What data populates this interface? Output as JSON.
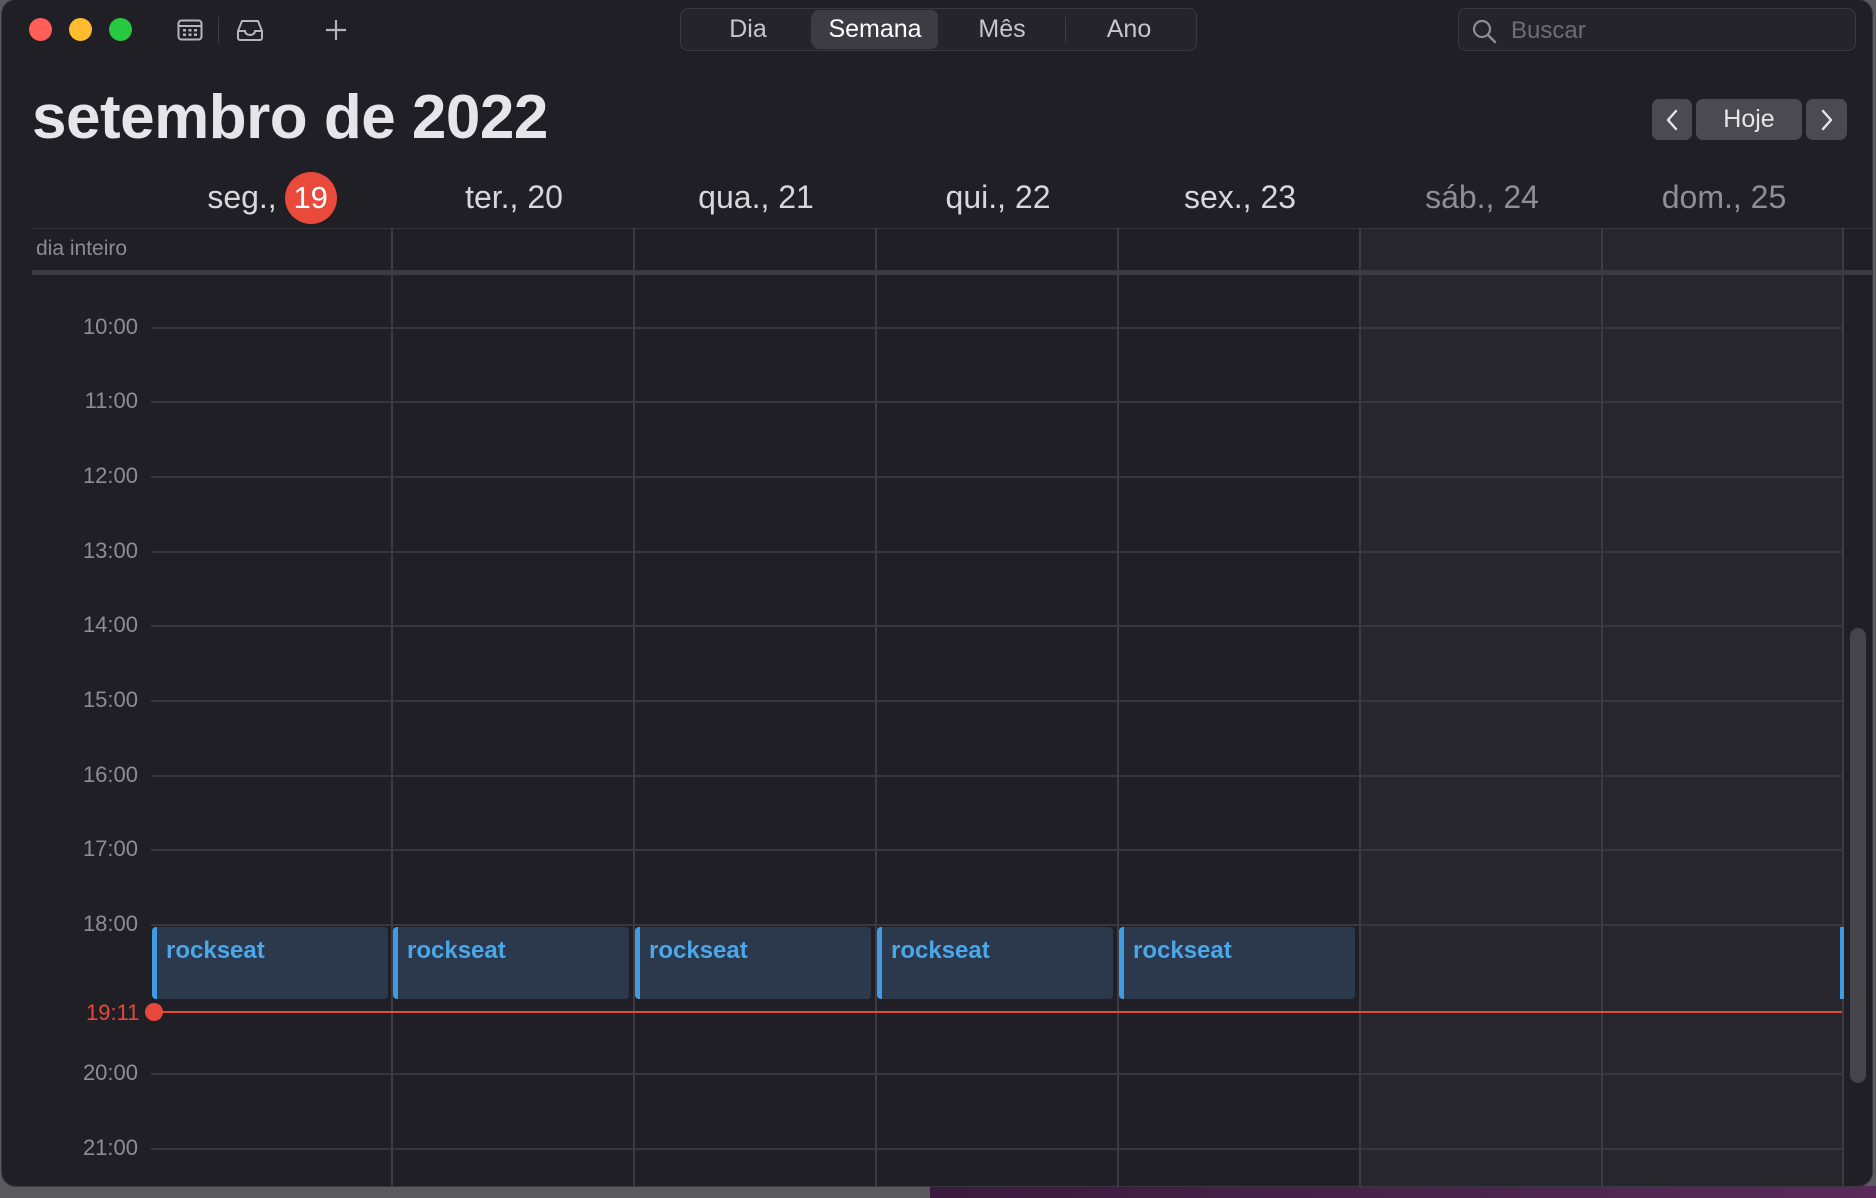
{
  "toolbar": {
    "view_tabs": [
      "Dia",
      "Semana",
      "Mês",
      "Ano"
    ],
    "active_view": "Semana",
    "search_placeholder": "Buscar"
  },
  "header": {
    "month_title": "setembro de 2022",
    "today_button": "Hoje"
  },
  "days": [
    {
      "label": "seg.,",
      "num": "19",
      "today": true
    },
    {
      "label": "ter., 20"
    },
    {
      "label": "qua., 21"
    },
    {
      "label": "qui., 22"
    },
    {
      "label": "sex., 23"
    },
    {
      "label": "sáb., 24",
      "weekend": true
    },
    {
      "label": "dom., 25",
      "weekend": true
    }
  ],
  "all_day_label": "dia inteiro",
  "hours": [
    "10:00",
    "11:00",
    "12:00",
    "13:00",
    "14:00",
    "15:00",
    "16:00",
    "17:00",
    "18:00",
    "20:00",
    "21:00"
  ],
  "events": [
    {
      "title": "rockseat"
    },
    {
      "title": "rockseat"
    },
    {
      "title": "rockseat"
    },
    {
      "title": "rockseat"
    },
    {
      "title": "rockseat"
    }
  ],
  "current_time": "19:11",
  "colors": {
    "today_accent": "#ea4a3c",
    "event_accent": "#3f9ce4",
    "now_line": "#e6493b"
  }
}
